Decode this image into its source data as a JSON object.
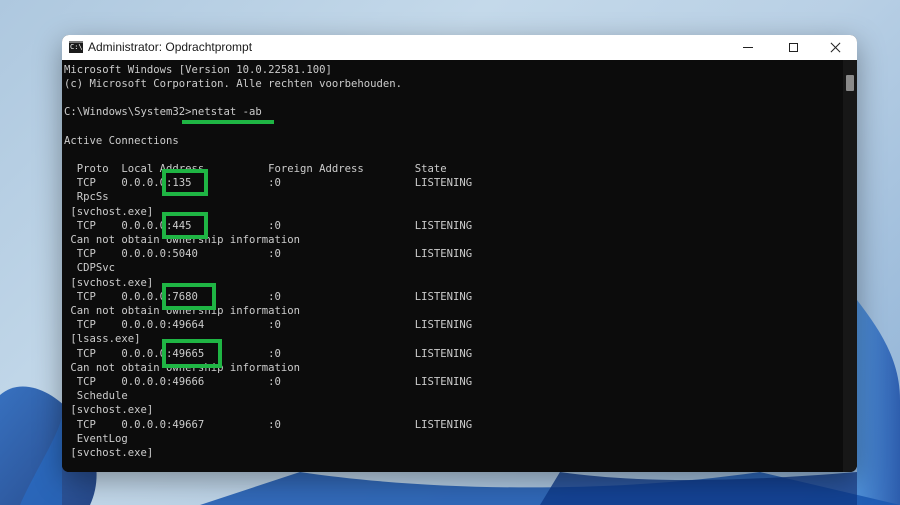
{
  "window": {
    "title": "Administrator: Opdrachtprompt",
    "minimize_glyph": "minimize",
    "maximize_glyph": "maximize",
    "close_glyph": "close"
  },
  "console": {
    "lines": [
      "Microsoft Windows [Version 10.0.22581.100]",
      "(c) Microsoft Corporation. Alle rechten voorbehouden.",
      "",
      "C:\\Windows\\System32>netstat -ab",
      "",
      "Active Connections",
      "",
      "  Proto  Local Address          Foreign Address        State",
      "  TCP    0.0.0.0:135            :0                     LISTENING",
      "  RpcSs",
      " [svchost.exe]",
      "  TCP    0.0.0.0:445            :0                     LISTENING",
      " Can not obtain ownership information",
      "  TCP    0.0.0.0:5040           :0                     LISTENING",
      "  CDPSvc",
      " [svchost.exe]",
      "  TCP    0.0.0.0:7680           :0                     LISTENING",
      " Can not obtain ownership information",
      "  TCP    0.0.0.0:49664          :0                     LISTENING",
      " [lsass.exe]",
      "  TCP    0.0.0.0:49665          :0                     LISTENING",
      " Can not obtain ownership information",
      "  TCP    0.0.0.0:49666          :0                     LISTENING",
      "  Schedule",
      " [svchost.exe]",
      "  TCP    0.0.0.0:49667          :0                     LISTENING",
      "  EventLog",
      " [svchost.exe]"
    ]
  },
  "highlights": {
    "color": "#1fb544",
    "ports": [
      "135",
      "445",
      "7680",
      "49665"
    ],
    "command": "netstat -ab"
  },
  "colors": {
    "console_bg": "#0c0c0c",
    "console_text": "#cccccc",
    "titlebar_bg": "#ffffff",
    "highlight": "#1fb544"
  },
  "icons": {
    "app": "command-prompt-icon"
  }
}
